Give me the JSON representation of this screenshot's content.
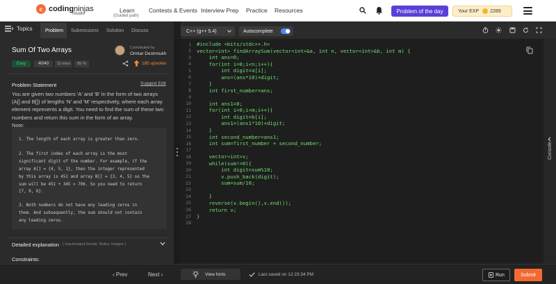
{
  "header": {
    "logo_mark": "c",
    "logo_bold": "coding",
    "logo_light": "ninjas",
    "logo_sub": "/studio",
    "nav": [
      "Learn",
      "Contests & Events",
      "Interview Prep",
      "Practice",
      "Resources"
    ],
    "nav_learn_sub": "(Guided path)",
    "problem_of_day": "Problem of the day",
    "exp_label": "Your EXP",
    "exp_value": "2289"
  },
  "left_tabs": {
    "topics": "Topics",
    "tabs": [
      "Problem",
      "Submissions",
      "Solution",
      "Discuss"
    ]
  },
  "problem": {
    "title": "Sum Of Two Arrays",
    "difficulty": "Easy",
    "score": "40/40",
    "time": "15 mins",
    "success": "85 %",
    "contributed_by": "Contributed by",
    "contributor": "Omkar Deshmukh",
    "upvotes": "185 upvotes",
    "statement_label": "Problem Statement",
    "suggest_edit": "Suggest Edit",
    "statement_lines": [
      "You are given two numbers 'A' and 'B' in the form of two arrays",
      "(A[] and B[]) of lengths 'N' and 'M' respectively, where each array",
      "element represents a digit. You need to find the sum of these two",
      "numbers and return this sum in the form of an array.",
      "Note:"
    ],
    "note_lines": [
      "1. The length of each array is greater than zero.",
      "",
      "2. The first index of each array is the most",
      "significant digit of the number. For example, if the",
      "array A[] = {4, 5, 1}, then the integer represented",
      "by this array is 451 and array B[] = {3, 4, 5} so the",
      "sum will be 451 + 345 = 796. So you need to return",
      "{7, 9, 6}.",
      "",
      "3. Both numbers do not have any leading zeros in",
      "them. And subsequently, the sum should not contain",
      "any leading zeros."
    ],
    "detailed_label": "Detailed explanation",
    "detailed_sub": "( Input/output format, Notes, Images )",
    "constraints_label": "Constraints:"
  },
  "editor": {
    "language": "C++ (g++ 5.4)",
    "autocomplete": "Autocomplete",
    "autocomplete_on": true,
    "lines": [
      "#include <bits/stdc++.h>",
      "vector<int> findArraySum(vector<int>&a, int n, vector<int>&b, int m) {",
      "    int ans=0;",
      "    for(int i=0;i<n;i++){",
      "        int digit=a[i];",
      "        ans=(ans*10)+digit;",
      "    }",
      "    int first_number=ans;",
      "",
      "    int ans1=0;",
      "    for(int i=0;i<m;i++){",
      "        int digit=b[i];",
      "        ans1=(ans1*10)+digit;",
      "    }",
      "    int second_number=ans1;",
      "    int sum=first_number + second_number;",
      "",
      "    vector<int>v;",
      "    while(sum!=0){",
      "        int digit=sum%10;",
      "        v.push_back(digit);",
      "        sum=sum/10;",
      "",
      "    }",
      "    reverse(v.begin(),v.end());",
      "    return v;",
      "}",
      ""
    ]
  },
  "console_label": "Console",
  "footer": {
    "prev": "Prev",
    "next": "Next",
    "view_hints": "View hints",
    "saved": "Last saved on 12:23:34 PM",
    "run": "Run",
    "submit": "Submit"
  }
}
